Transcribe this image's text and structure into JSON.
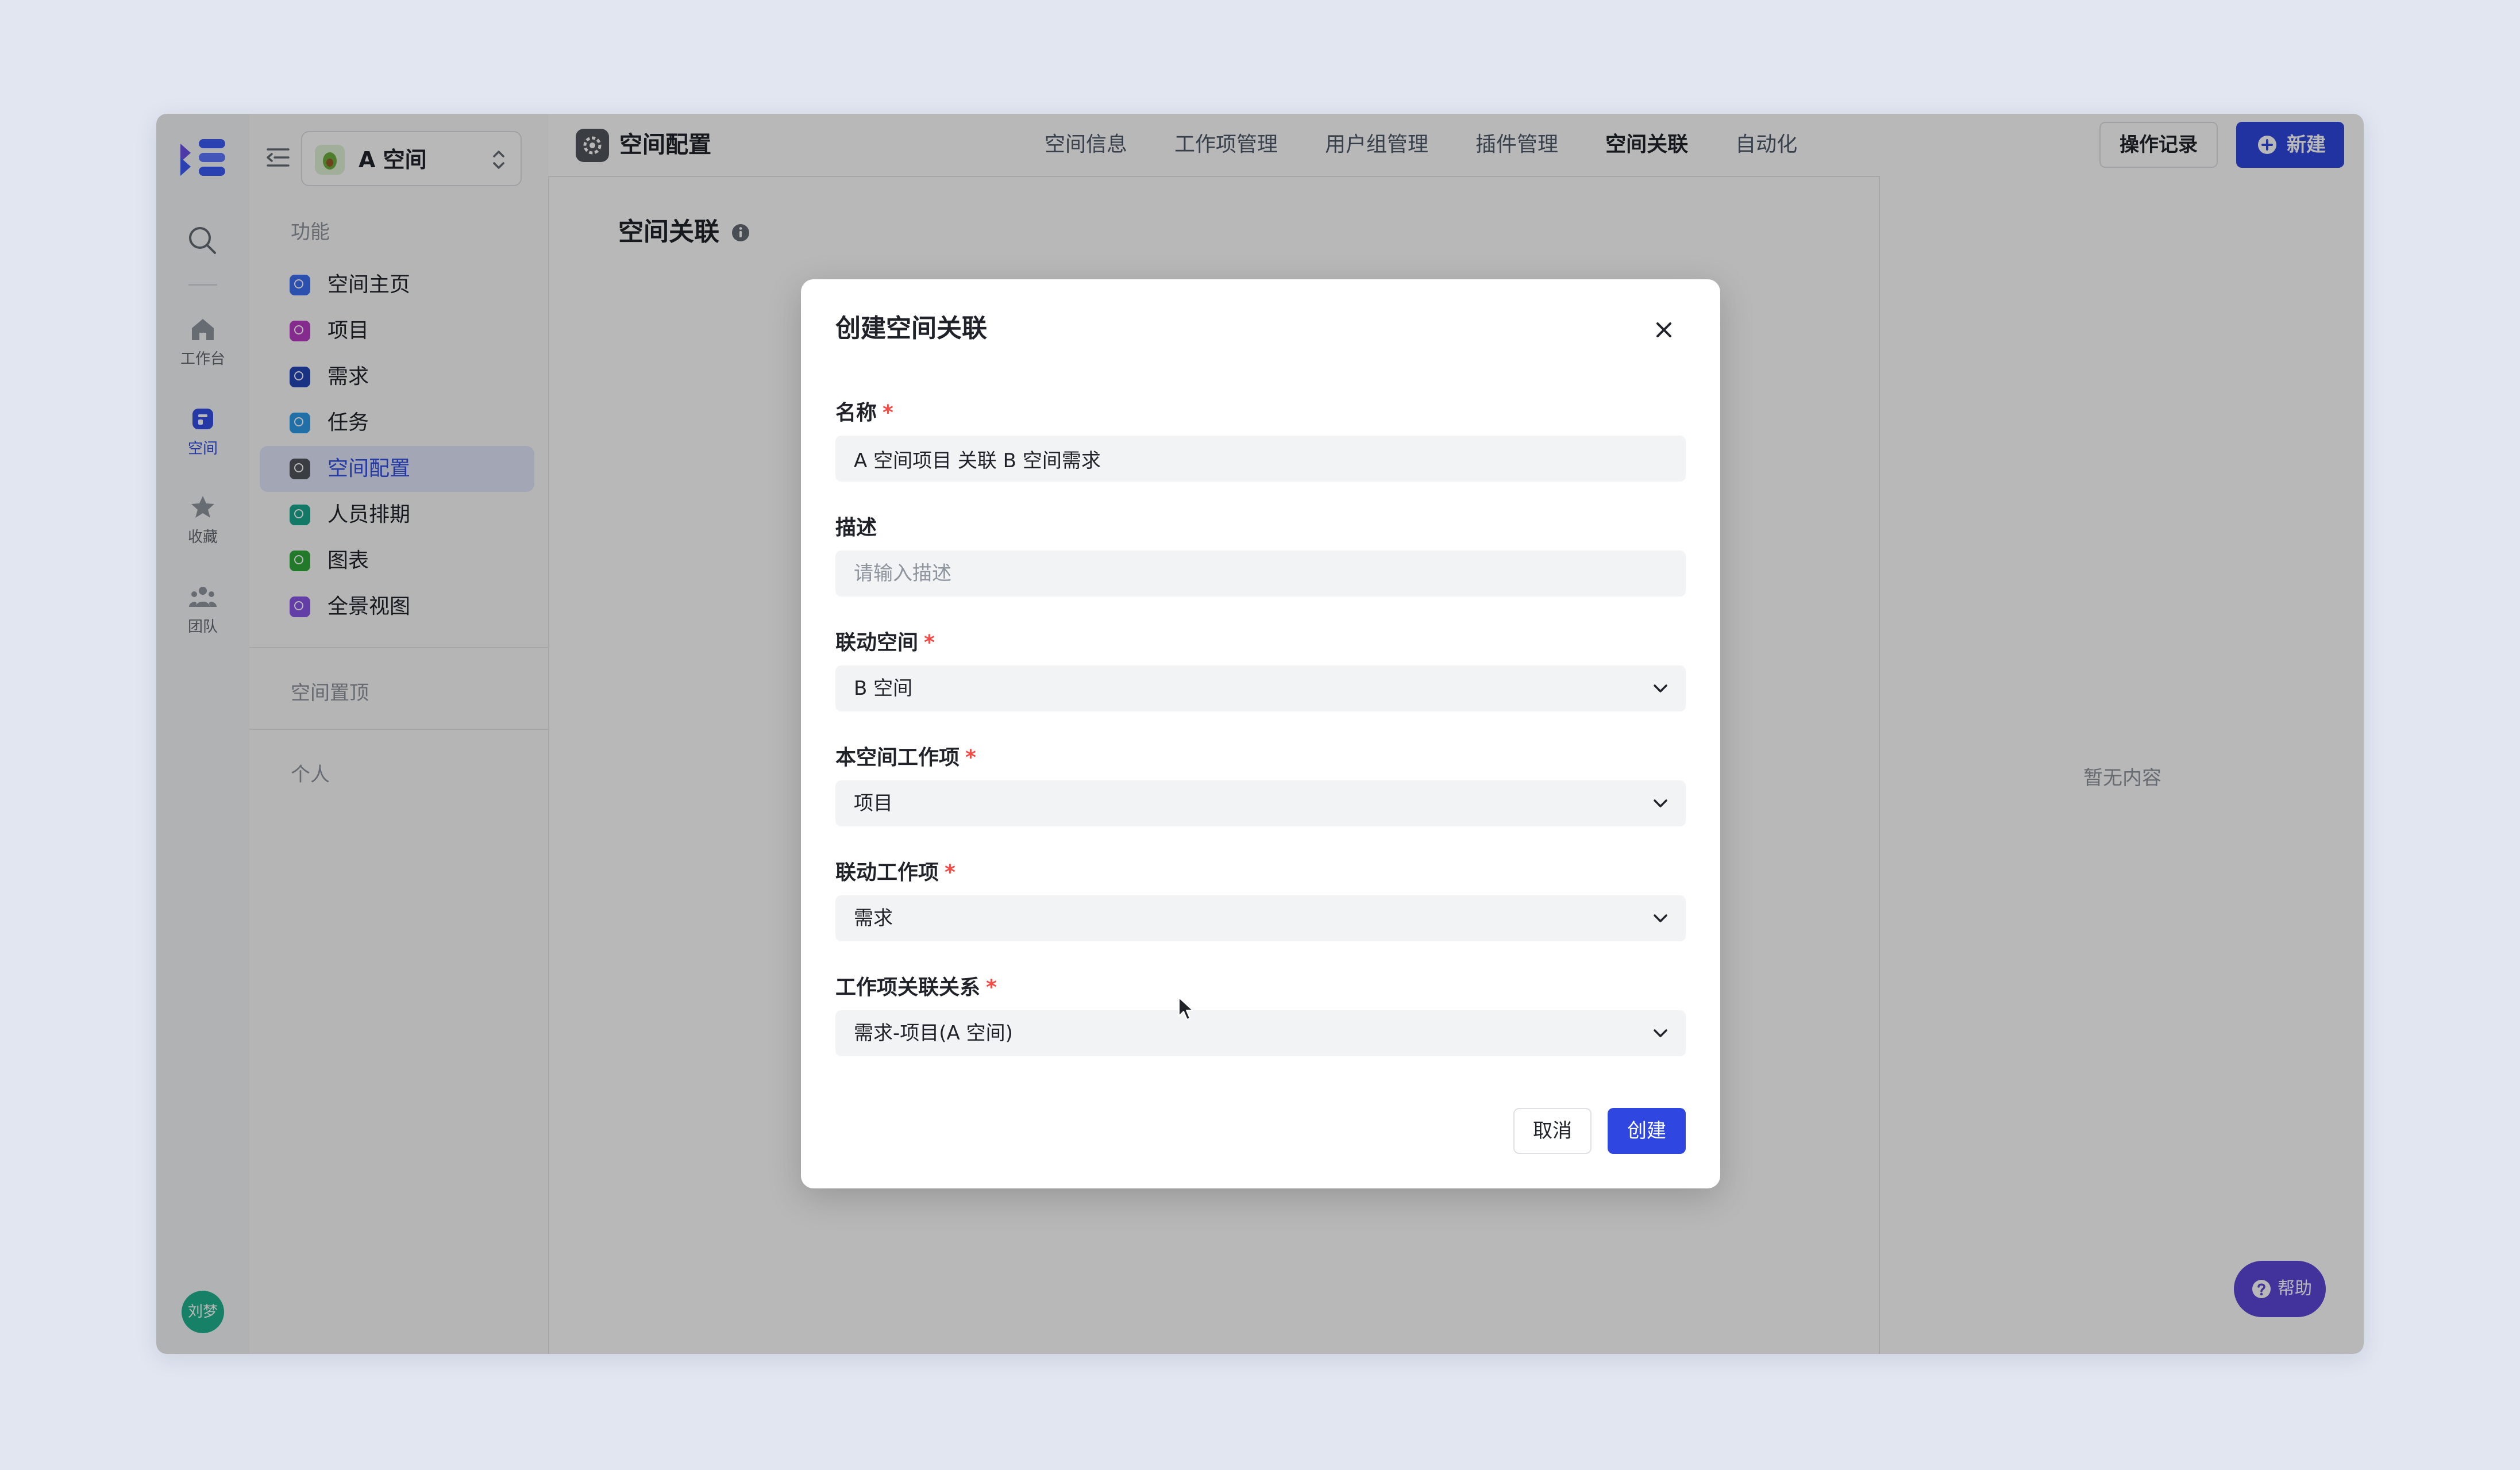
{
  "rail": {
    "items": [
      {
        "label": "工作台",
        "icon": "home-icon"
      },
      {
        "label": "空间",
        "icon": "space-icon"
      },
      {
        "label": "收藏",
        "icon": "star-icon"
      },
      {
        "label": "团队",
        "icon": "team-icon"
      }
    ],
    "avatar": "刘梦"
  },
  "sidebar": {
    "space_name": "A 空间",
    "section_feature": "功能",
    "items": [
      {
        "label": "空间主页",
        "icon": "space-home-icon",
        "color": "#3d6ff2"
      },
      {
        "label": "项目",
        "icon": "project-icon",
        "color": "#b83cc4"
      },
      {
        "label": "需求",
        "icon": "requirement-icon",
        "color": "#2446b8"
      },
      {
        "label": "任务",
        "icon": "task-icon",
        "color": "#2f9ae8"
      },
      {
        "label": "空间配置",
        "icon": "space-config-icon",
        "color": "#51565d"
      },
      {
        "label": "人员排期",
        "icon": "schedule-icon",
        "color": "#1aa88f"
      },
      {
        "label": "图表",
        "icon": "chart-icon",
        "color": "#2fa83a"
      },
      {
        "label": "全景视图",
        "icon": "panorama-icon",
        "color": "#8a57e6"
      }
    ],
    "section_pinned": "空间置顶",
    "section_personal": "个人"
  },
  "topbar": {
    "title": "空间配置",
    "tabs": [
      "空间信息",
      "工作项管理",
      "用户组管理",
      "插件管理",
      "空间关联",
      "自动化"
    ],
    "log_button": "操作记录",
    "new_button": "新建"
  },
  "content": {
    "title": "空间关联",
    "empty_text": "暂无内容",
    "help_label": "帮助"
  },
  "modal": {
    "title": "创建空间关联",
    "name_label": "名称",
    "name_value": "A 空间项目 关联 B 空间需求",
    "desc_label": "描述",
    "desc_placeholder": "请输入描述",
    "linked_space_label": "联动空间",
    "linked_space_value": "B 空间",
    "own_item_label": "本空间工作项",
    "own_item_value": "项目",
    "linked_item_label": "联动工作项",
    "linked_item_value": "需求",
    "relation_label": "工作项关联关系",
    "relation_value": "需求-项目(A 空间)",
    "required_mark": "*",
    "cancel_button": "取消",
    "create_button": "创建"
  },
  "colors": {
    "accent": "#2f47e0",
    "required": "#f54a45",
    "active_bg": "#e1e6fb",
    "help": "#5b46d8"
  }
}
